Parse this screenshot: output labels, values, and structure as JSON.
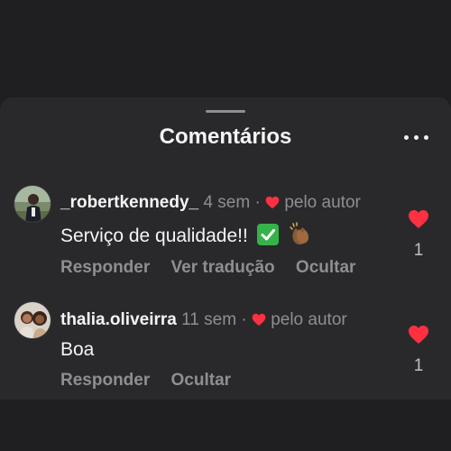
{
  "header": {
    "title": "Comentários"
  },
  "comments": [
    {
      "username": "_robertkennedy_",
      "time": "4 sem",
      "separator": "·",
      "liked_by_author": "pelo autor",
      "text": "Serviço de qualidade!!",
      "emojis": [
        "check-mark-icon",
        "clapping-hands-icon"
      ],
      "actions": [
        "Responder",
        "Ver tradução",
        "Ocultar"
      ],
      "likes": "1"
    },
    {
      "username": "thalia.oliveirra",
      "time": "11 sem",
      "separator": "·",
      "liked_by_author": "pelo autor",
      "text": "Boa",
      "actions": [
        "Responder",
        "Ocultar"
      ],
      "likes": "1"
    }
  ],
  "colors": {
    "heart": "#ff3040",
    "background": "#29292c",
    "secondary_text": "#8e8e93"
  }
}
